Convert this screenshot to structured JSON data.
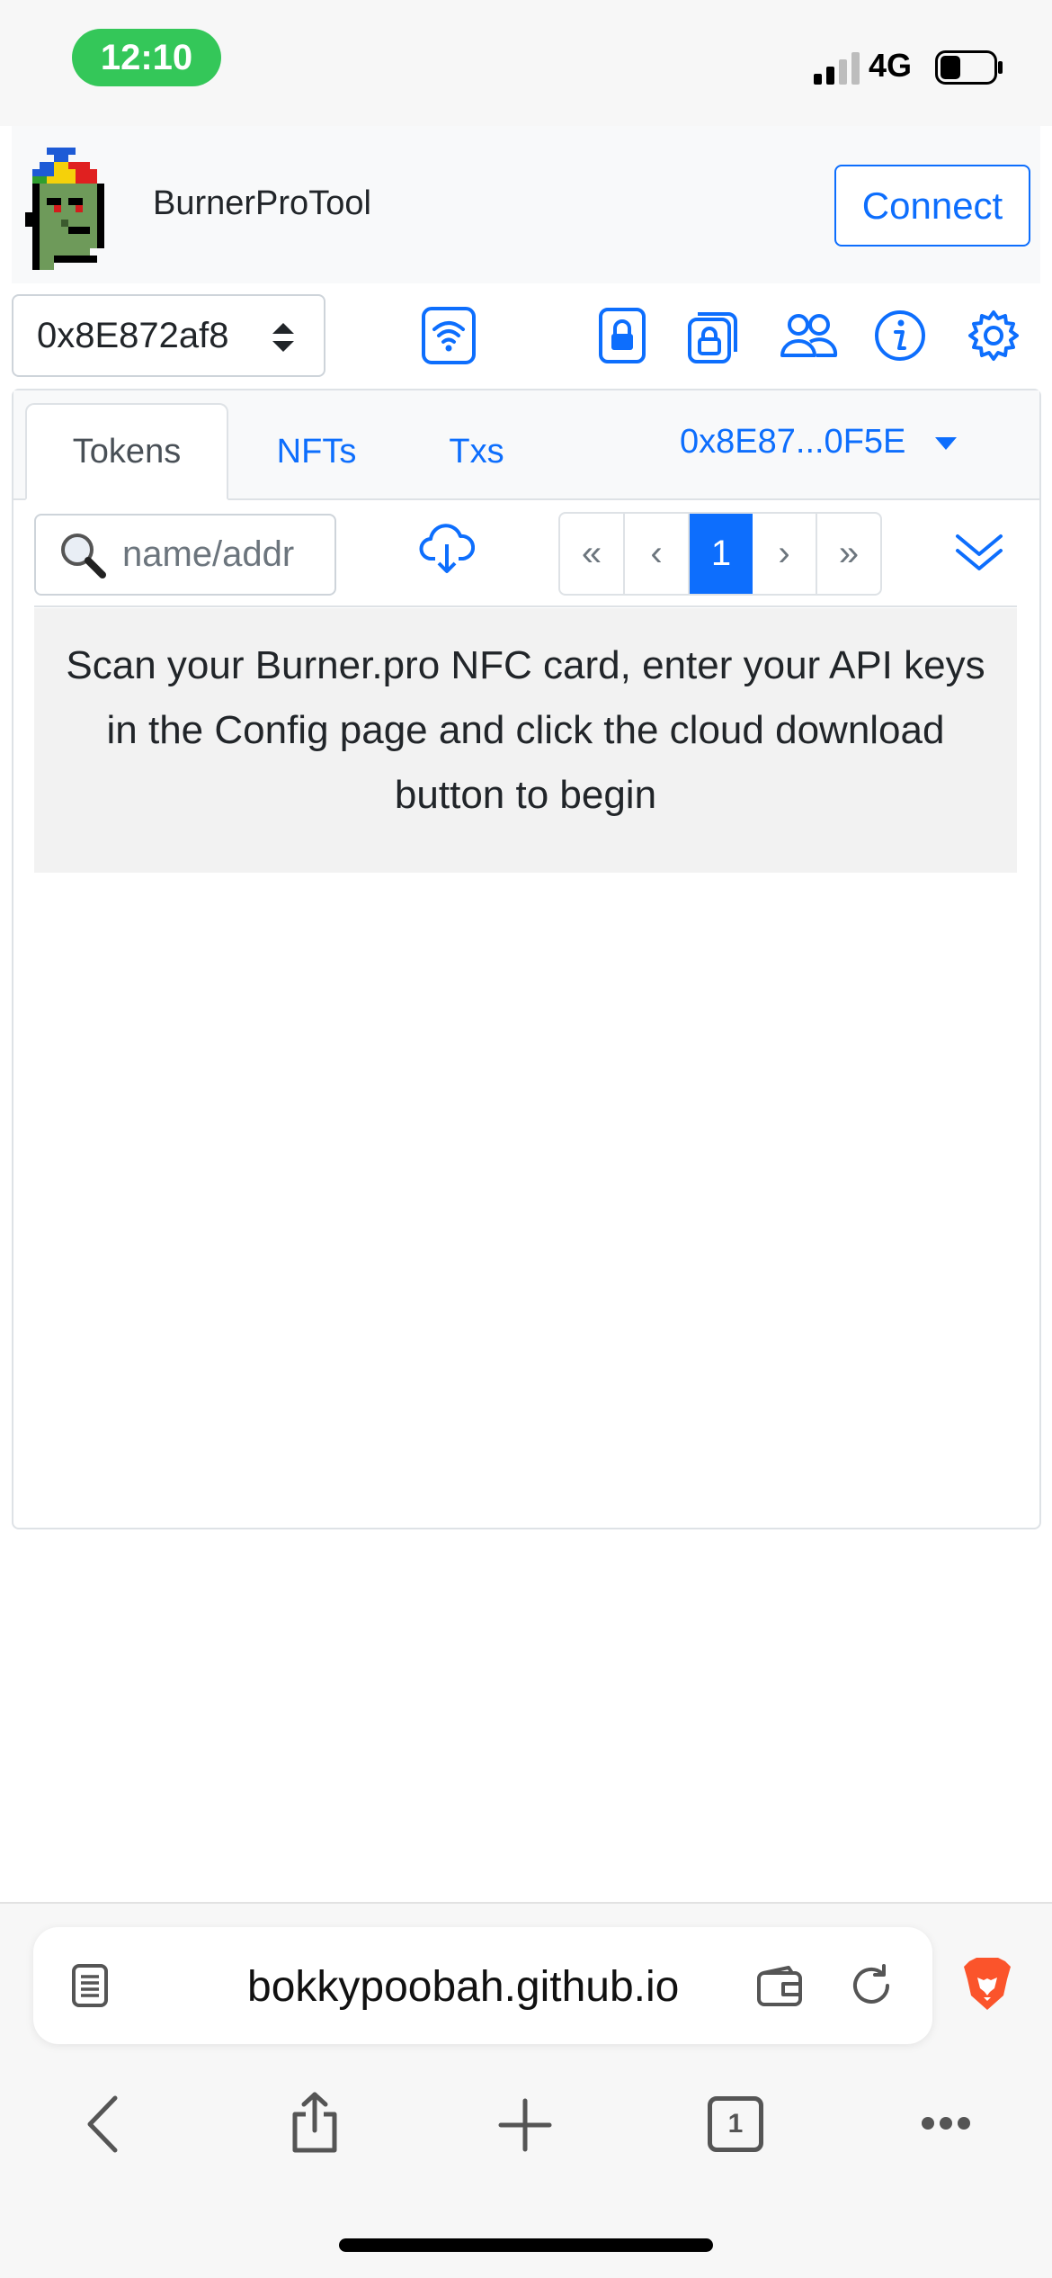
{
  "status_bar": {
    "time": "12:10",
    "network": "4G"
  },
  "app": {
    "title": "BurnerProTool",
    "connect_label": "Connect"
  },
  "toolbar": {
    "address_selected": "0x8E872af8",
    "icons": [
      "wifi-nfc-icon",
      "lock-icon",
      "multi-lock-icon",
      "people-icon",
      "info-icon",
      "gear-icon"
    ]
  },
  "tabs": [
    {
      "label": "Tokens",
      "active": true
    },
    {
      "label": "NFTs",
      "active": false
    },
    {
      "label": "Txs",
      "active": false
    }
  ],
  "account_dropdown": "0x8E87...0F5E",
  "filter": {
    "search_placeholder": "name/addr",
    "pagination": {
      "first": "«",
      "prev": "‹",
      "current": "1",
      "next": "›",
      "last": "»"
    }
  },
  "notice": "Scan your Burner.pro NFC card, enter your API keys in the Config page and click the cloud download button to begin",
  "browser": {
    "url": "bokkypoobah.github.io",
    "tab_count": "1"
  },
  "colors": {
    "primary": "#0d6efd",
    "status_green": "#34c759",
    "brave_orange": "#fb542b"
  }
}
